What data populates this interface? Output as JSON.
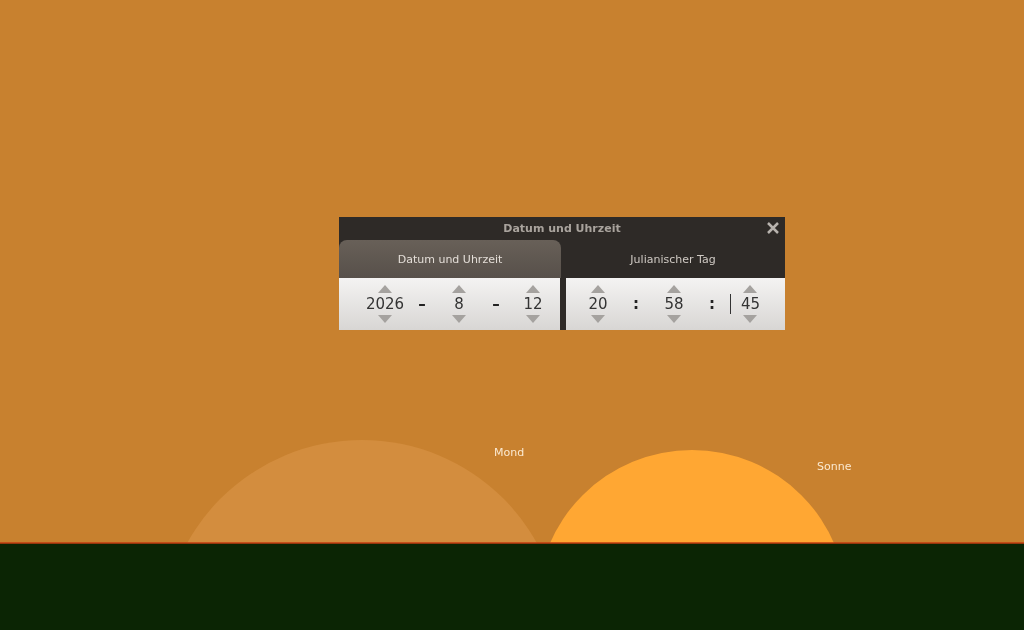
{
  "sky_labels": [
    {
      "text": "Mond"
    },
    {
      "text": "Sonne"
    }
  ],
  "dialog": {
    "title": "Datum und Uhrzeit",
    "tabs": [
      {
        "label": "Datum und Uhrzeit",
        "selected": true
      },
      {
        "label": "Julianischer Tag",
        "selected": false
      }
    ],
    "date": [
      {
        "kind": "spinner",
        "value": "2026",
        "focused": false
      },
      {
        "kind": "separator",
        "value": "–"
      },
      {
        "kind": "spinner",
        "value": "8",
        "focused": false
      },
      {
        "kind": "separator",
        "value": "–"
      },
      {
        "kind": "spinner",
        "value": "12",
        "focused": false
      }
    ],
    "time": [
      {
        "kind": "spinner",
        "value": "20",
        "focused": false
      },
      {
        "kind": "separator",
        "value": ":"
      },
      {
        "kind": "spinner",
        "value": "58",
        "focused": false
      },
      {
        "kind": "separator",
        "value": ":"
      },
      {
        "kind": "spinner",
        "value": "45",
        "focused": true
      }
    ]
  }
}
